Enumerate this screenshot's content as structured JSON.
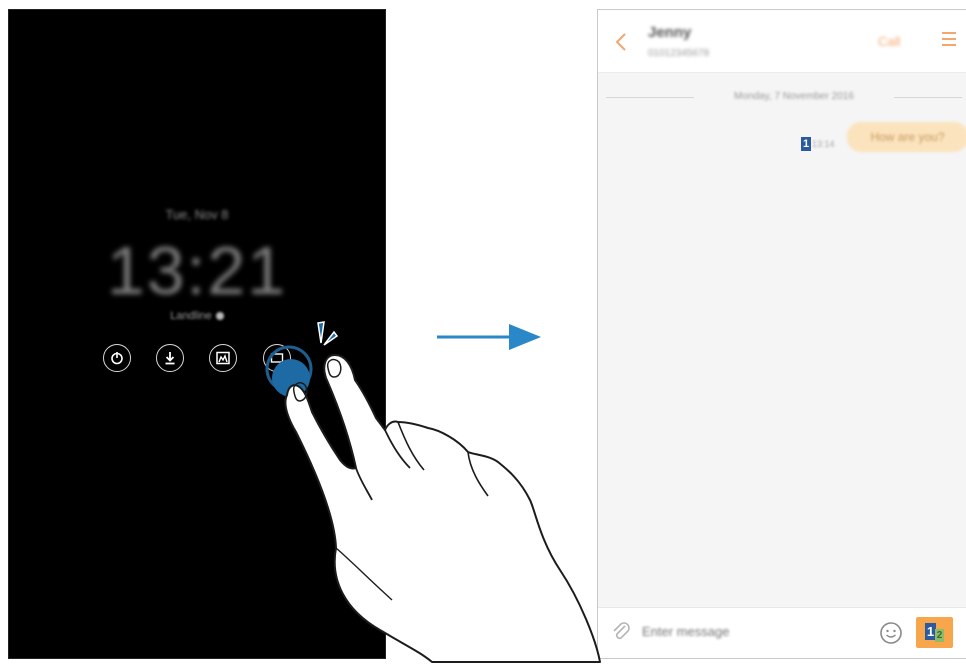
{
  "aod": {
    "date": "Tue, Nov 8",
    "time": "13:21",
    "status": "Landline",
    "icons": [
      "power-icon",
      "download-icon",
      "gallery-icon",
      "message-icon"
    ]
  },
  "chat": {
    "contact_name": "Jenny",
    "contact_number": "01012345678",
    "call_label": "Call",
    "date_divider": "Monday, 7 November 2016",
    "message": "How are you?",
    "message_sim": "1",
    "message_time": "13:14",
    "input_placeholder": "Enter message",
    "send_sim_primary": "1",
    "send_sim_secondary": "2",
    "colors": {
      "accent": "#f7a64b",
      "bubble": "#fbe3bd",
      "sim": "#2a5aa0"
    }
  }
}
